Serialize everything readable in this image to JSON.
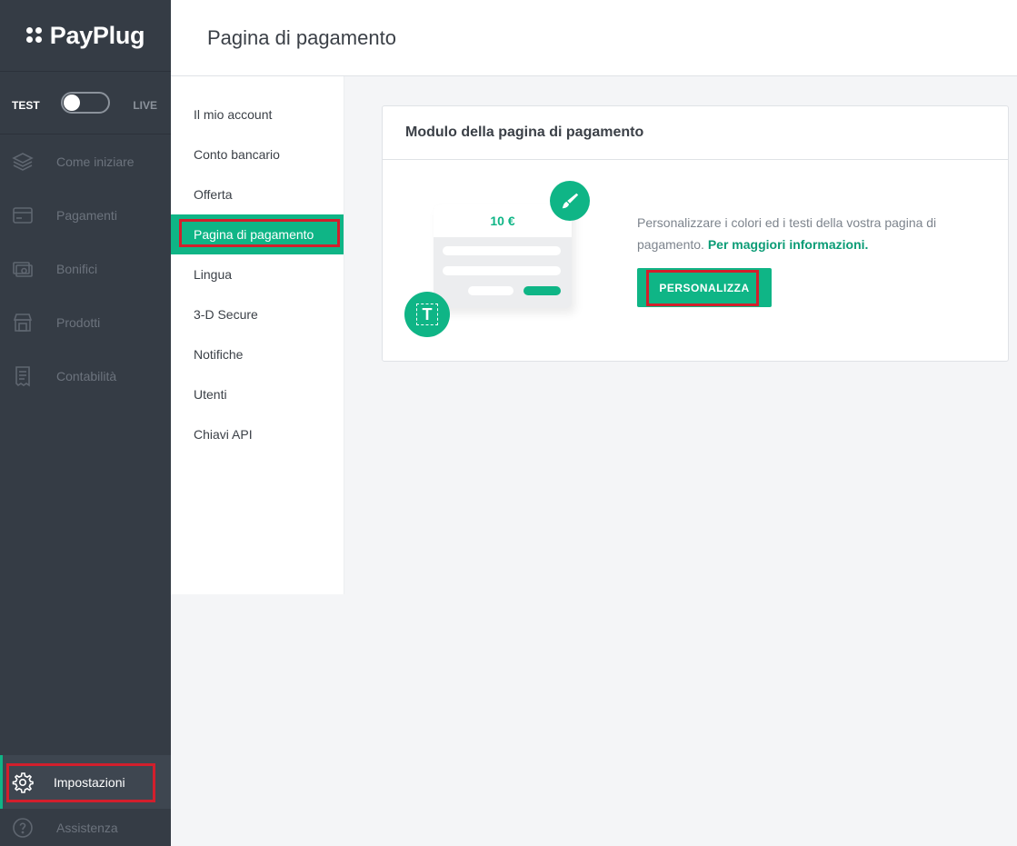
{
  "sidebar": {
    "logo": "PayPlug",
    "env_test": "TEST",
    "env_live": "LIVE",
    "items": [
      {
        "label": "Come iniziare",
        "icon": "layers-icon"
      },
      {
        "label": "Pagamenti",
        "icon": "card-icon"
      },
      {
        "label": "Bonifici",
        "icon": "banknote-icon"
      },
      {
        "label": "Prodotti",
        "icon": "store-icon"
      },
      {
        "label": "Contabilità",
        "icon": "receipt-icon"
      }
    ],
    "settings_label": "Impostazioni",
    "help_label": "Assistenza"
  },
  "header": {
    "title": "Pagina di pagamento"
  },
  "submenu": {
    "items": [
      "Il mio account",
      "Conto bancario",
      "Offerta",
      "Pagina di pagamento",
      "Lingua",
      "3-D Secure",
      "Notifiche",
      "Utenti",
      "Chiavi API"
    ],
    "active_index": 3
  },
  "card": {
    "title": "Modulo della pagina di pagamento",
    "description": "Personalizzare i colori ed i testi della vostra pagina di pagamento.",
    "link": "Per maggiori informazioni.",
    "button": "PERSONALIZZA",
    "illustration_amount": "10 €",
    "illustration_text_icon": "T"
  },
  "colors": {
    "accent": "#0fb586",
    "sidebar": "#353c45",
    "highlight": "#d21f2c"
  }
}
